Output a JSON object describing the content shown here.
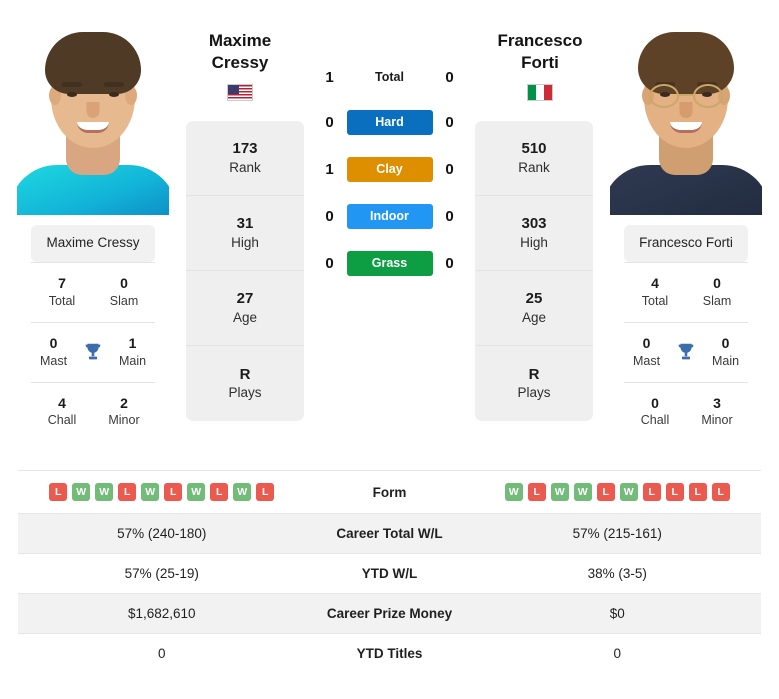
{
  "players": {
    "left": {
      "first_name": "Maxime",
      "last_name": "Cressy",
      "full_name": "Maxime Cressy",
      "flag": "us-flag-icon",
      "country": "United States",
      "rank": "173",
      "rank_label": "Rank",
      "high": "31",
      "high_label": "High",
      "age": "27",
      "age_label": "Age",
      "plays": "R",
      "plays_label": "Plays",
      "titles": {
        "total": "7",
        "total_label": "Total",
        "slam": "0",
        "slam_label": "Slam",
        "mast": "0",
        "mast_label": "Mast",
        "main": "1",
        "main_label": "Main",
        "chall": "4",
        "chall_label": "Chall",
        "minor": "2",
        "minor_label": "Minor"
      },
      "form": [
        "L",
        "W",
        "W",
        "L",
        "W",
        "L",
        "W",
        "L",
        "W",
        "L"
      ],
      "career_wl": "57% (240-180)",
      "ytd_wl": "57% (25-19)",
      "prize_money": "$1,682,610",
      "ytd_titles": "0"
    },
    "right": {
      "first_name": "Francesco",
      "last_name": "Forti",
      "full_name": "Francesco Forti",
      "flag": "it-flag-icon",
      "country": "Italy",
      "rank": "510",
      "rank_label": "Rank",
      "high": "303",
      "high_label": "High",
      "age": "25",
      "age_label": "Age",
      "plays": "R",
      "plays_label": "Plays",
      "titles": {
        "total": "4",
        "total_label": "Total",
        "slam": "0",
        "slam_label": "Slam",
        "mast": "0",
        "mast_label": "Mast",
        "main": "0",
        "main_label": "Main",
        "chall": "0",
        "chall_label": "Chall",
        "minor": "3",
        "minor_label": "Minor"
      },
      "form": [
        "W",
        "L",
        "W",
        "W",
        "L",
        "W",
        "L",
        "L",
        "L",
        "L"
      ],
      "career_wl": "57% (215-161)",
      "ytd_wl": "38% (3-5)",
      "prize_money": "$0",
      "ytd_titles": "0"
    }
  },
  "head_to_head": [
    {
      "label": "Total",
      "left": "1",
      "right": "0",
      "badge": false,
      "color": ""
    },
    {
      "label": "Hard",
      "left": "0",
      "right": "0",
      "badge": true,
      "color": "#0b6fc0"
    },
    {
      "label": "Clay",
      "left": "1",
      "right": "0",
      "badge": true,
      "color": "#dd8f00"
    },
    {
      "label": "Indoor",
      "left": "0",
      "right": "0",
      "badge": true,
      "color": "#2196f3"
    },
    {
      "label": "Grass",
      "left": "0",
      "right": "0",
      "badge": true,
      "color": "#0d9e44"
    }
  ],
  "comparison_rows": [
    {
      "label": "Form",
      "type": "form"
    },
    {
      "label": "Career Total W/L",
      "type": "text",
      "left_key": "career_wl",
      "right_key": "career_wl"
    },
    {
      "label": "YTD W/L",
      "type": "text",
      "left_key": "ytd_wl",
      "right_key": "ytd_wl"
    },
    {
      "label": "Career Prize Money",
      "type": "text",
      "left_key": "prize_money",
      "right_key": "prize_money"
    },
    {
      "label": "YTD Titles",
      "type": "text",
      "left_key": "ytd_titles",
      "right_key": "ytd_titles"
    }
  ],
  "icons": {
    "trophy": "trophy-icon",
    "win_badge": "win-badge",
    "loss_badge": "loss-badge"
  },
  "colors": {
    "hard": "#0b6fc0",
    "clay": "#dd8f00",
    "indoor": "#2196f3",
    "grass": "#0d9e44",
    "win": "#72bb79",
    "loss": "#ea5a4e",
    "trophy": "#3b6cab",
    "card_bg": "#efefef",
    "row_shade": "#f2f2f2"
  }
}
